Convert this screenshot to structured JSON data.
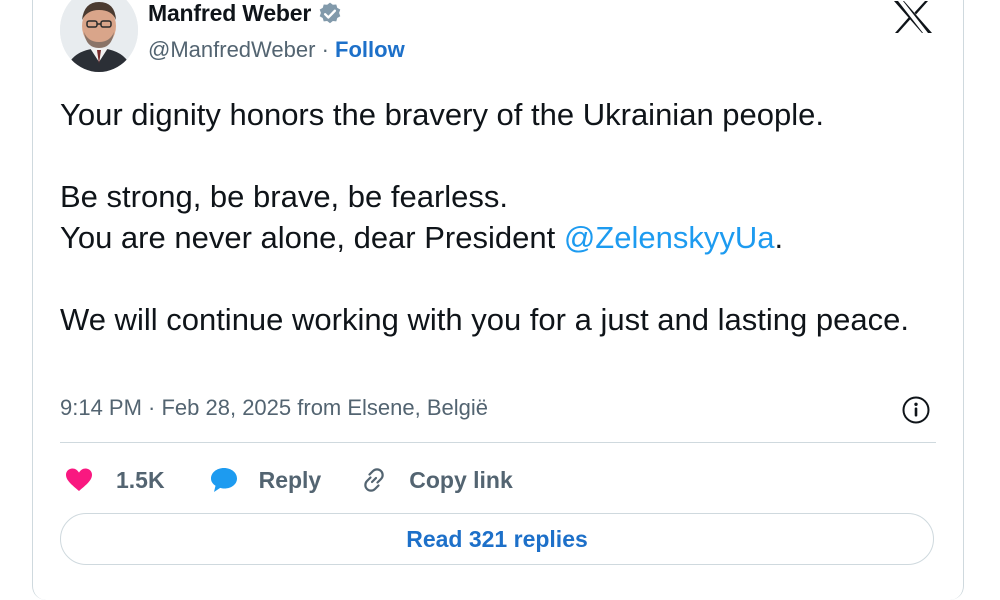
{
  "author": {
    "name": "Manfred Weber",
    "handle": "@ManfredWeber",
    "separator": "·",
    "follow_label": "Follow"
  },
  "tweet": {
    "line1": "Your dignity honors the bravery of the Ukrainian people.",
    "line2": "Be strong, be brave, be fearless.",
    "line3_prefix": "You are never alone, dear President ",
    "mention": "@ZelenskyyUa",
    "line3_suffix": ".",
    "line4": "We will continue working with you for a just and lasting peace."
  },
  "meta": {
    "timestamp": "9:14 PM · Feb 28, 2025 from Elsene, België"
  },
  "actions": {
    "like_count": "1.5K",
    "reply_label": "Reply",
    "copy_link_label": "Copy link"
  },
  "read_replies_label": "Read 321 replies",
  "colors": {
    "like": "#f91880",
    "reply": "#1d9bf0",
    "link": "#1d70c9",
    "muted": "#536471",
    "border": "#cfd9de"
  },
  "icons": [
    "verified-badge-icon",
    "x-logo-icon",
    "info-icon",
    "heart-icon",
    "reply-bubble-icon",
    "link-icon"
  ]
}
